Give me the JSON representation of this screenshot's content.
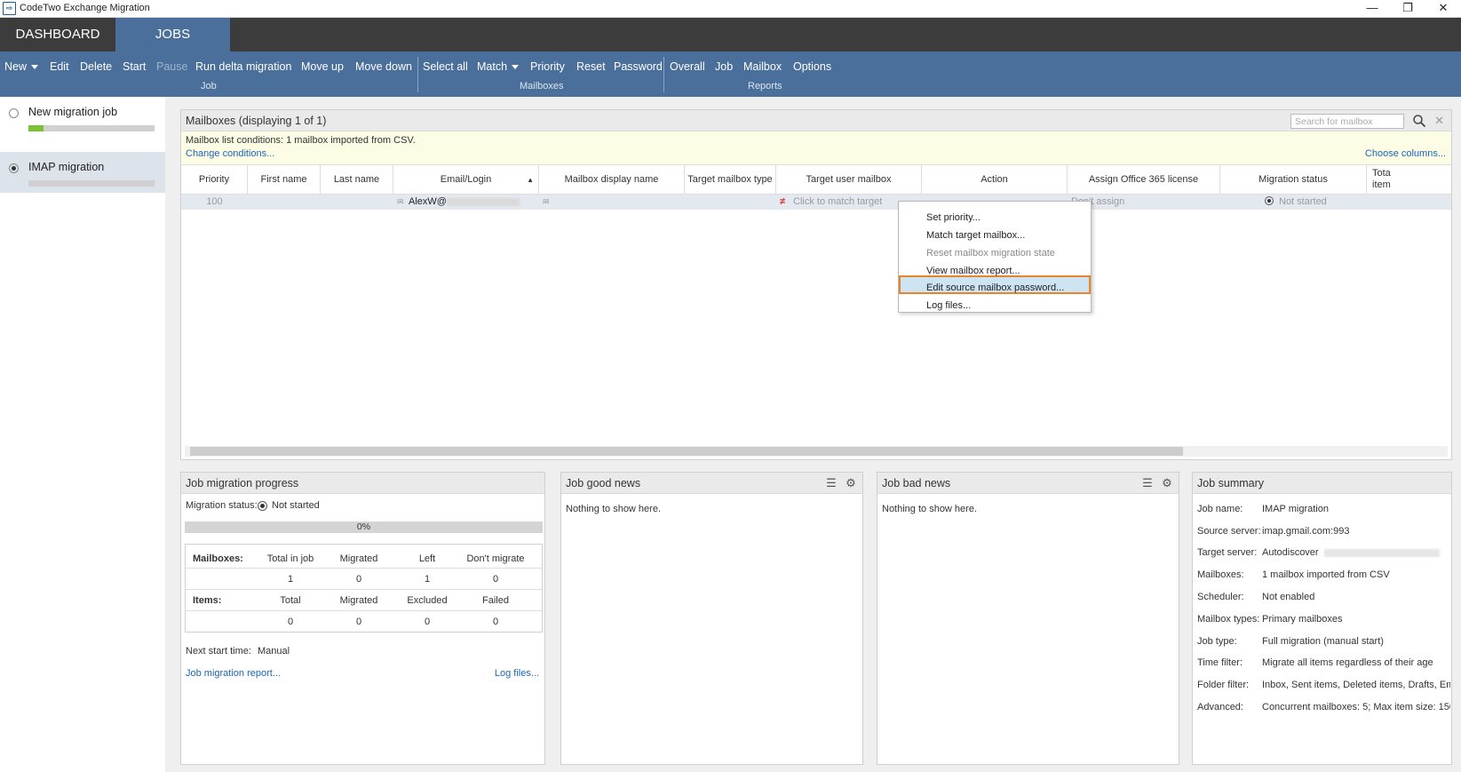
{
  "window": {
    "title": "CodeTwo Exchange Migration",
    "app_icon_glyph": "⇨",
    "minimize": "—",
    "restore": "❐",
    "close": "✕"
  },
  "main_tabs": [
    {
      "label": "DASHBOARD"
    },
    {
      "label": "JOBS"
    }
  ],
  "ribbon": {
    "job": {
      "group_label": "Job",
      "new": "New",
      "edit": "Edit",
      "delete": "Delete",
      "start": "Start",
      "pause": "Pause",
      "run_delta": "Run delta migration",
      "move_up": "Move up",
      "move_down": "Move down"
    },
    "mailboxes": {
      "group_label": "Mailboxes",
      "select_all": "Select all",
      "match": "Match",
      "priority": "Priority",
      "reset": "Reset",
      "password": "Password"
    },
    "reports": {
      "group_label": "Reports",
      "overall": "Overall",
      "job": "Job",
      "mailbox": "Mailbox",
      "options": "Options"
    }
  },
  "sidebar": {
    "jobs": [
      {
        "name": "New migration job",
        "progress": 0.12,
        "selected": false
      },
      {
        "name": "IMAP migration",
        "progress": 0,
        "selected": true
      }
    ]
  },
  "mailboxes_panel": {
    "title": "Mailboxes (displaying 1 of 1)",
    "search_placeholder": "Search for mailbox",
    "conditions_text": "Mailbox list conditions: 1 mailbox imported from CSV.",
    "change_conditions": "Change conditions...",
    "choose_columns": "Choose columns...",
    "columns": [
      "Priority",
      "First name",
      "Last name",
      "Email/Login",
      "Mailbox display name",
      "Target mailbox type",
      "Target user mailbox",
      "Action",
      "Assign Office 365 license",
      "Migration status",
      "Tota item"
    ],
    "sort_indicator": "▲",
    "row": {
      "priority": "100",
      "first_name": "",
      "last_name": "",
      "email": "AlexW@",
      "display_name": "",
      "target_type": "",
      "target_user": "Click to match target",
      "action": "",
      "license": "Don't assign",
      "status": "Not started"
    }
  },
  "context_menu": {
    "items": [
      {
        "label": "Set priority...",
        "disabled": false
      },
      {
        "label": "Match target mailbox...",
        "disabled": false
      },
      {
        "label": "Reset mailbox migration state",
        "disabled": true
      },
      {
        "label": "View mailbox report...",
        "disabled": false
      },
      {
        "label": "Edit source mailbox password...",
        "disabled": false,
        "highlighted": true
      },
      {
        "label": "Log files...",
        "disabled": false
      }
    ]
  },
  "progress_panel": {
    "title": "Job migration progress",
    "status_label": "Migration status:",
    "status_value": "Not started",
    "percent": "0%",
    "progress": 0,
    "mailboxes": {
      "label": "Mailboxes:",
      "headers": [
        "Total in job",
        "Migrated",
        "Left",
        "Don't migrate"
      ],
      "values": [
        "1",
        "0",
        "1",
        "0"
      ]
    },
    "items": {
      "label": "Items:",
      "headers": [
        "Total",
        "Migrated",
        "Excluded",
        "Failed"
      ],
      "values": [
        "0",
        "0",
        "0",
        "0"
      ]
    },
    "next_start_label": "Next start time:",
    "next_start_value": "Manual",
    "report_link": "Job migration report...",
    "log_link": "Log files..."
  },
  "good_news": {
    "title": "Job good news",
    "empty": "Nothing to show here."
  },
  "bad_news": {
    "title": "Job bad news",
    "empty": "Nothing to show here."
  },
  "summary": {
    "title": "Job summary",
    "rows": [
      {
        "key": "Job name:",
        "value": "IMAP migration"
      },
      {
        "key": "Source server:",
        "value": "imap.gmail.com:993"
      },
      {
        "key": "Target server:",
        "value": "Autodiscover"
      },
      {
        "key": "Mailboxes:",
        "value": "1 mailbox imported from CSV"
      },
      {
        "key": "Scheduler:",
        "value": "Not enabled"
      },
      {
        "key": "Mailbox types:",
        "value": "Primary mailboxes"
      },
      {
        "key": "Job type:",
        "value": "Full migration (manual start)"
      },
      {
        "key": "Time filter:",
        "value": "Migrate all items regardless of their age"
      },
      {
        "key": "Folder filter:",
        "value": "Inbox, Sent items, Deleted items, Drafts, Em..."
      },
      {
        "key": "Advanced:",
        "value": "Concurrent mailboxes: 5; Max item size: 150..."
      }
    ]
  },
  "colors": {
    "ribbon": "#4a6f9a",
    "tabbar": "#3c3c3c",
    "progress_green": "#7cc035",
    "link": "#1a66b8",
    "highlight_border": "#e8842a"
  }
}
